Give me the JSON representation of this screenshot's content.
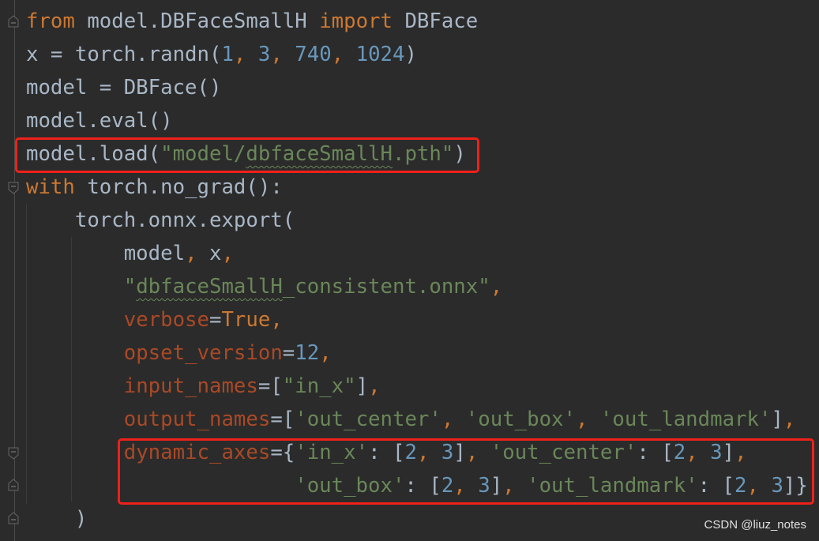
{
  "colors": {
    "background": "#2b2b2b",
    "default": "#a9b7c6",
    "keyword": "#cc7832",
    "number": "#6897bb",
    "string": "#6a8759",
    "param": "#aa4926",
    "highlight_box": "#f0201a"
  },
  "editor": {
    "lines": [
      [
        [
          "keyword",
          "from"
        ],
        [
          "default",
          " model.DBFaceSmallH "
        ],
        [
          "keyword",
          "import"
        ],
        [
          "default",
          " DBFace"
        ]
      ],
      [
        [
          "default",
          "x = torch.randn("
        ],
        [
          "number",
          "1"
        ],
        [
          "keyword",
          ", "
        ],
        [
          "number",
          "3"
        ],
        [
          "keyword",
          ", "
        ],
        [
          "number",
          "740"
        ],
        [
          "keyword",
          ", "
        ],
        [
          "number",
          "1024"
        ],
        [
          "default",
          ")"
        ]
      ],
      [
        [
          "default",
          "model = DBFace()"
        ]
      ],
      [
        [
          "default",
          "model.eval()"
        ]
      ],
      [
        [
          "default",
          "model.load("
        ],
        [
          "string",
          "\"model/"
        ],
        [
          "string-squig",
          "dbfaceSmallH"
        ],
        [
          "string",
          ".pth\""
        ],
        [
          "default",
          ")"
        ]
      ],
      [
        [
          "keyword",
          "with"
        ],
        [
          "default",
          " torch.no_grad():"
        ]
      ],
      [
        [
          "default",
          "    torch.onnx.export("
        ]
      ],
      [
        [
          "default",
          "        model"
        ],
        [
          "keyword",
          ", "
        ],
        [
          "default",
          "x"
        ],
        [
          "keyword",
          ","
        ]
      ],
      [
        [
          "default",
          "        "
        ],
        [
          "string",
          "\""
        ],
        [
          "string-squig",
          "dbfaceSmallH"
        ],
        [
          "string",
          "_consistent.onnx\""
        ],
        [
          "keyword",
          ","
        ]
      ],
      [
        [
          "default",
          "        "
        ],
        [
          "param",
          "verbose"
        ],
        [
          "default",
          "="
        ],
        [
          "keyword",
          "True,"
        ]
      ],
      [
        [
          "default",
          "        "
        ],
        [
          "param",
          "opset_version"
        ],
        [
          "default",
          "="
        ],
        [
          "number",
          "12"
        ],
        [
          "keyword",
          ","
        ]
      ],
      [
        [
          "default",
          "        "
        ],
        [
          "param",
          "input_names"
        ],
        [
          "default",
          "=["
        ],
        [
          "string",
          "\"in_x\""
        ],
        [
          "default",
          "]"
        ],
        [
          "keyword",
          ","
        ]
      ],
      [
        [
          "default",
          "        "
        ],
        [
          "param",
          "output_names"
        ],
        [
          "default",
          "=["
        ],
        [
          "string",
          "'out_center'"
        ],
        [
          "keyword",
          ", "
        ],
        [
          "string",
          "'out_box'"
        ],
        [
          "keyword",
          ", "
        ],
        [
          "string",
          "'out_landmark'"
        ],
        [
          "default",
          "]"
        ],
        [
          "keyword",
          ","
        ]
      ],
      [
        [
          "default",
          "        "
        ],
        [
          "param",
          "dynamic_axes"
        ],
        [
          "default",
          "={"
        ],
        [
          "string",
          "'in_x'"
        ],
        [
          "default",
          ": ["
        ],
        [
          "number",
          "2"
        ],
        [
          "keyword",
          ", "
        ],
        [
          "number",
          "3"
        ],
        [
          "default",
          "]"
        ],
        [
          "keyword",
          ", "
        ],
        [
          "string",
          "'out_center'"
        ],
        [
          "default",
          ": ["
        ],
        [
          "number",
          "2"
        ],
        [
          "keyword",
          ", "
        ],
        [
          "number",
          "3"
        ],
        [
          "default",
          "]"
        ],
        [
          "keyword",
          ","
        ]
      ],
      [
        [
          "default",
          "                      "
        ],
        [
          "string",
          "'out_box'"
        ],
        [
          "default",
          ": ["
        ],
        [
          "number",
          "2"
        ],
        [
          "keyword",
          ", "
        ],
        [
          "number",
          "3"
        ],
        [
          "default",
          "]"
        ],
        [
          "keyword",
          ", "
        ],
        [
          "string",
          "'out_landmark'"
        ],
        [
          "default",
          ": ["
        ],
        [
          "number",
          "2"
        ],
        [
          "keyword",
          ", "
        ],
        [
          "number",
          "3"
        ],
        [
          "default",
          "]}"
        ]
      ],
      [
        [
          "default",
          "    )"
        ]
      ]
    ]
  },
  "watermark": "CSDN @liuz_notes"
}
